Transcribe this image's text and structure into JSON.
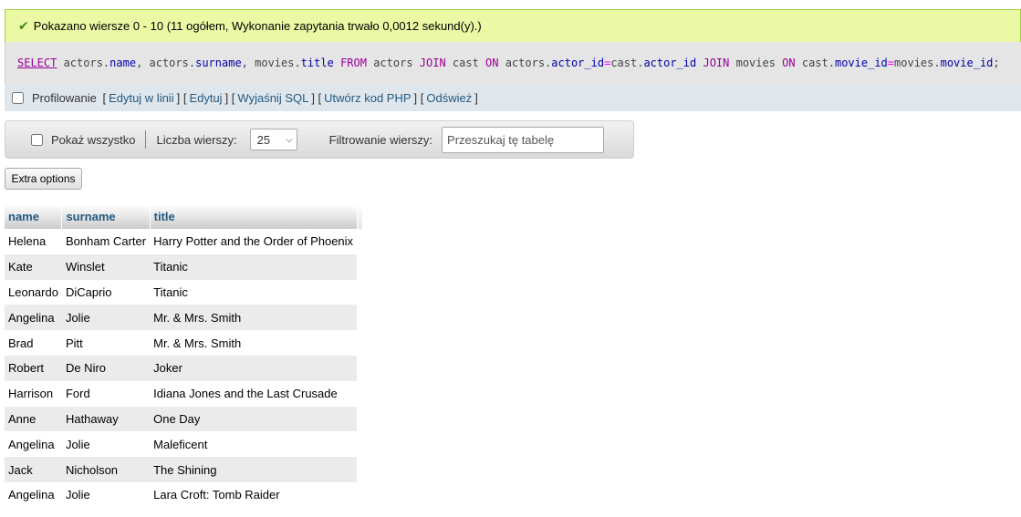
{
  "success": {
    "icon": "check-icon",
    "message": "Pokazano wiersze 0 - 10 (11 ogółem, Wykonanie zapytania trwało 0,0012 sekund(y).)",
    "color": "#ebf8a4"
  },
  "sql": {
    "parts": [
      {
        "t": "SELECT",
        "c": "kw u"
      },
      {
        "t": " actors.",
        "c": ""
      },
      {
        "t": "name",
        "c": "fld"
      },
      {
        "t": ", actors.",
        "c": ""
      },
      {
        "t": "surname",
        "c": "fld"
      },
      {
        "t": ", movies.",
        "c": ""
      },
      {
        "t": "title",
        "c": "fld"
      },
      {
        "t": " ",
        "c": ""
      },
      {
        "t": "FROM",
        "c": "kw"
      },
      {
        "t": " actors ",
        "c": ""
      },
      {
        "t": "JOIN",
        "c": "kw"
      },
      {
        "t": " cast ",
        "c": ""
      },
      {
        "t": "ON",
        "c": "kw"
      },
      {
        "t": " actors.",
        "c": ""
      },
      {
        "t": "actor_id",
        "c": "fld"
      },
      {
        "t": "=",
        "c": "op"
      },
      {
        "t": "cast.",
        "c": ""
      },
      {
        "t": "actor_id",
        "c": "fld"
      },
      {
        "t": " ",
        "c": ""
      },
      {
        "t": "JOIN",
        "c": "kw"
      },
      {
        "t": " movies ",
        "c": ""
      },
      {
        "t": "ON",
        "c": "kw"
      },
      {
        "t": " cast.",
        "c": ""
      },
      {
        "t": "movie_id",
        "c": "fld"
      },
      {
        "t": "=",
        "c": "op"
      },
      {
        "t": "movies.",
        "c": ""
      },
      {
        "t": "movie_id",
        "c": "fld"
      },
      {
        "t": ";",
        "c": ""
      }
    ]
  },
  "tools": {
    "profiling_label": "Profilowanie",
    "links": [
      "Edytuj w linii",
      "Edytuj",
      "Wyjaśnij SQL",
      "Utwórz kod PHP",
      "Odśwież"
    ]
  },
  "nav": {
    "show_all_label": "Pokaż wszystko",
    "rows_label": "Liczba wierszy:",
    "rows_value": "25",
    "filter_label": "Filtrowanie wierszy:",
    "filter_placeholder": "Przeszukaj tę tabelę"
  },
  "extra_options_label": "Extra options",
  "table": {
    "columns": [
      "name",
      "surname",
      "title"
    ],
    "rows": [
      [
        "Helena",
        "Bonham Carter",
        "Harry Potter and the Order of Phoenix"
      ],
      [
        "Kate",
        "Winslet",
        "Titanic"
      ],
      [
        "Leonardo",
        "DiCaprio",
        "Titanic"
      ],
      [
        "Angelina",
        "Jolie",
        "Mr. & Mrs. Smith"
      ],
      [
        "Brad",
        "Pitt",
        "Mr. & Mrs. Smith"
      ],
      [
        "Robert",
        "De Niro",
        "Joker"
      ],
      [
        "Harrison",
        "Ford",
        "Idiana Jones and the Last Crusade"
      ],
      [
        "Anne",
        "Hathaway",
        "One Day"
      ],
      [
        "Angelina",
        "Jolie",
        "Maleficent"
      ],
      [
        "Jack",
        "Nicholson",
        "The Shining"
      ],
      [
        "Angelina",
        "Jolie",
        "Lara Croft: Tomb Raider"
      ]
    ]
  }
}
